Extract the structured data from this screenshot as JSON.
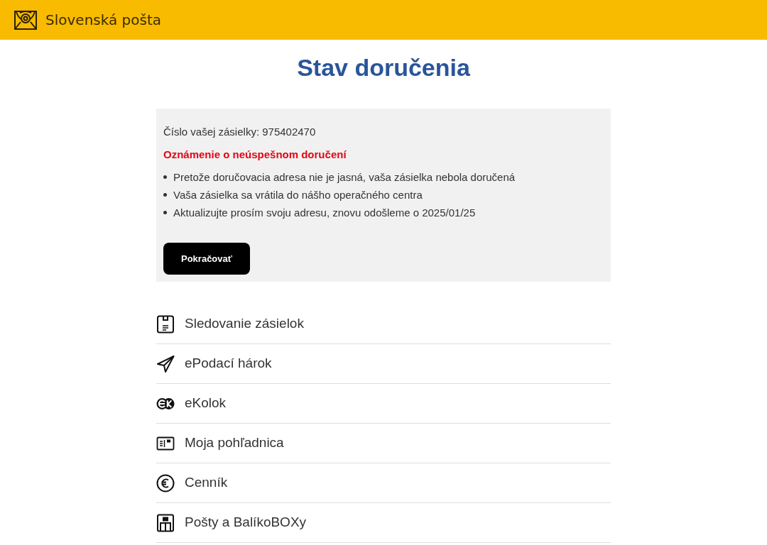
{
  "header": {
    "brand": "Slovenská pošta"
  },
  "title": "Stav doručenia",
  "notice": {
    "tracking_number": "Číslo vašej zásielky: 975402470",
    "alert": "Oznámenie o neúspešnom doručení",
    "reasons": [
      "Pretože doručovacia adresa nie je jasná, vaša zásielka nebola doručená",
      "Vaša zásielka sa vrátila do nášho operačného centra",
      "Aktualizujte prosím svoju adresu, znovu odošleme o 2025/01/25"
    ],
    "button": "Pokračovať"
  },
  "menu": [
    {
      "label": "Sledovanie zásielok"
    },
    {
      "label": "ePodací hárok"
    },
    {
      "label": "eKolok"
    },
    {
      "label": "Moja pohľadnica"
    },
    {
      "label": "Cenník"
    },
    {
      "label": "Pošty a BalíkoBOXy"
    }
  ]
}
